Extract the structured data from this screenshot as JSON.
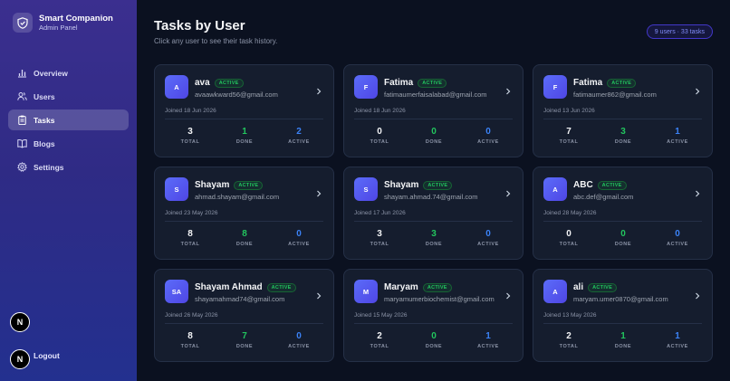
{
  "app": {
    "title": "Smart Companion",
    "subtitle": "Admin Panel"
  },
  "nav": {
    "items": [
      {
        "label": "Overview",
        "icon": "chart-icon",
        "active": false
      },
      {
        "label": "Users",
        "icon": "users-icon",
        "active": false
      },
      {
        "label": "Tasks",
        "icon": "clipboard-icon",
        "active": true
      },
      {
        "label": "Blogs",
        "icon": "book-icon",
        "active": false
      },
      {
        "label": "Settings",
        "icon": "gear-icon",
        "active": false
      }
    ],
    "avatar_letter": "N",
    "logout_label": "Logout"
  },
  "page": {
    "title": "Tasks by User",
    "subtitle": "Click any user to see their task history.",
    "summary": "9 users · 33 tasks"
  },
  "stat_labels": {
    "total": "TOTAL",
    "done": "DONE",
    "active": "ACTIVE"
  },
  "users": [
    {
      "initials": "A",
      "name": "ava",
      "status": "ACTIVE",
      "email": "avaawkward56@gmail.com",
      "joined": "Joined 18 Jun 2026",
      "total": "3",
      "done": "1",
      "active": "2"
    },
    {
      "initials": "F",
      "name": "Fatima",
      "status": "ACTIVE",
      "email": "fatimaumerfaisalabad@gmail.com",
      "joined": "Joined 18 Jun 2026",
      "total": "0",
      "done": "0",
      "active": "0"
    },
    {
      "initials": "F",
      "name": "Fatima",
      "status": "ACTIVE",
      "email": "fatimaumer862@gmail.com",
      "joined": "Joined 13 Jun 2026",
      "total": "7",
      "done": "3",
      "active": "1"
    },
    {
      "initials": "S",
      "name": "Shayam",
      "status": "ACTIVE",
      "email": "ahmad.shayam@gmail.com",
      "joined": "Joined 23 May 2026",
      "total": "8",
      "done": "8",
      "active": "0"
    },
    {
      "initials": "S",
      "name": "Shayam",
      "status": "ACTIVE",
      "email": "shayam.ahmad.74@gmail.com",
      "joined": "Joined 17 Jun 2026",
      "total": "3",
      "done": "3",
      "active": "0"
    },
    {
      "initials": "A",
      "name": "ABC",
      "status": "ACTIVE",
      "email": "abc.def@gmail.com",
      "joined": "Joined 28 May 2026",
      "total": "0",
      "done": "0",
      "active": "0"
    },
    {
      "initials": "SA",
      "name": "Shayam Ahmad",
      "status": "ACTIVE",
      "email": "shayamahmad74@gmail.com",
      "joined": "Joined 26 May 2026",
      "total": "8",
      "done": "7",
      "active": "0"
    },
    {
      "initials": "M",
      "name": "Maryam",
      "status": "ACTIVE",
      "email": "maryamumerbiochemist@gmail.com",
      "joined": "Joined 15 May 2026",
      "total": "2",
      "done": "0",
      "active": "1"
    },
    {
      "initials": "A",
      "name": "ali",
      "status": "ACTIVE",
      "email": "maryam.umer0870@gmail.com",
      "joined": "Joined 13 May 2026",
      "total": "2",
      "done": "1",
      "active": "1"
    }
  ],
  "colors": {
    "accent": "#4f46e5",
    "done": "#22c55e",
    "active": "#3b82f6",
    "card_bg": "#151d2e",
    "page_bg": "#0b1120"
  }
}
